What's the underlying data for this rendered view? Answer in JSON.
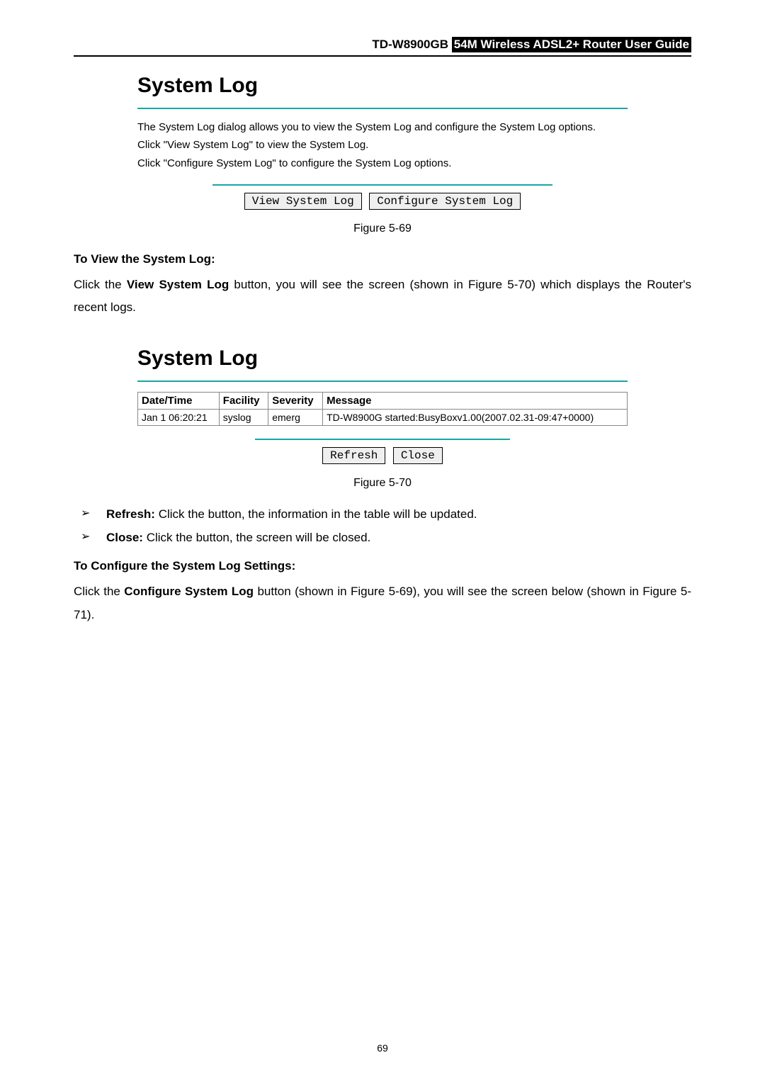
{
  "header": {
    "model": "TD-W8900GB",
    "title": "54M  Wireless  ADSL2+  Router  User  Guide"
  },
  "panel1": {
    "title": "System Log",
    "desc1": "The System Log dialog allows you to view the System Log and configure the System Log options.",
    "desc2": "Click \"View System Log\" to view the System Log.",
    "desc3": "Click \"Configure System Log\" to configure the System Log options.",
    "btn_view": "View System Log",
    "btn_configure": "Configure System Log"
  },
  "fig1_caption": "Figure 5-69",
  "section1_heading": "To View the System Log:",
  "section1_body_pre": "Click the ",
  "section1_body_bold": "View System Log",
  "section1_body_post": " button, you will see the screen (shown in Figure 5-70) which displays the Router's recent logs.",
  "panel2": {
    "title": "System Log",
    "headers": {
      "dt": "Date/Time",
      "fac": "Facility",
      "sev": "Severity",
      "msg": "Message"
    },
    "row": {
      "dt": "Jan 1 06:20:21",
      "fac": "syslog",
      "sev": "emerg",
      "msg": "TD-W8900G started:BusyBoxv1.00(2007.02.31-09:47+0000)"
    },
    "btn_refresh": "Refresh",
    "btn_close": "Close"
  },
  "fig2_caption": "Figure 5-70",
  "bullets": {
    "refresh_label": "Refresh:",
    "refresh_text": " Click the button, the information in the table will be updated.",
    "close_label": "Close:",
    "close_text": " Click the button, the screen will be closed."
  },
  "section2_heading": "To Configure the System Log Settings:",
  "section2_body_pre": "Click the ",
  "section2_body_bold": "Configure System Log",
  "section2_body_post": " button (shown in Figure 5-69), you will see the screen below (shown in Figure 5-71).",
  "page_number": "69"
}
